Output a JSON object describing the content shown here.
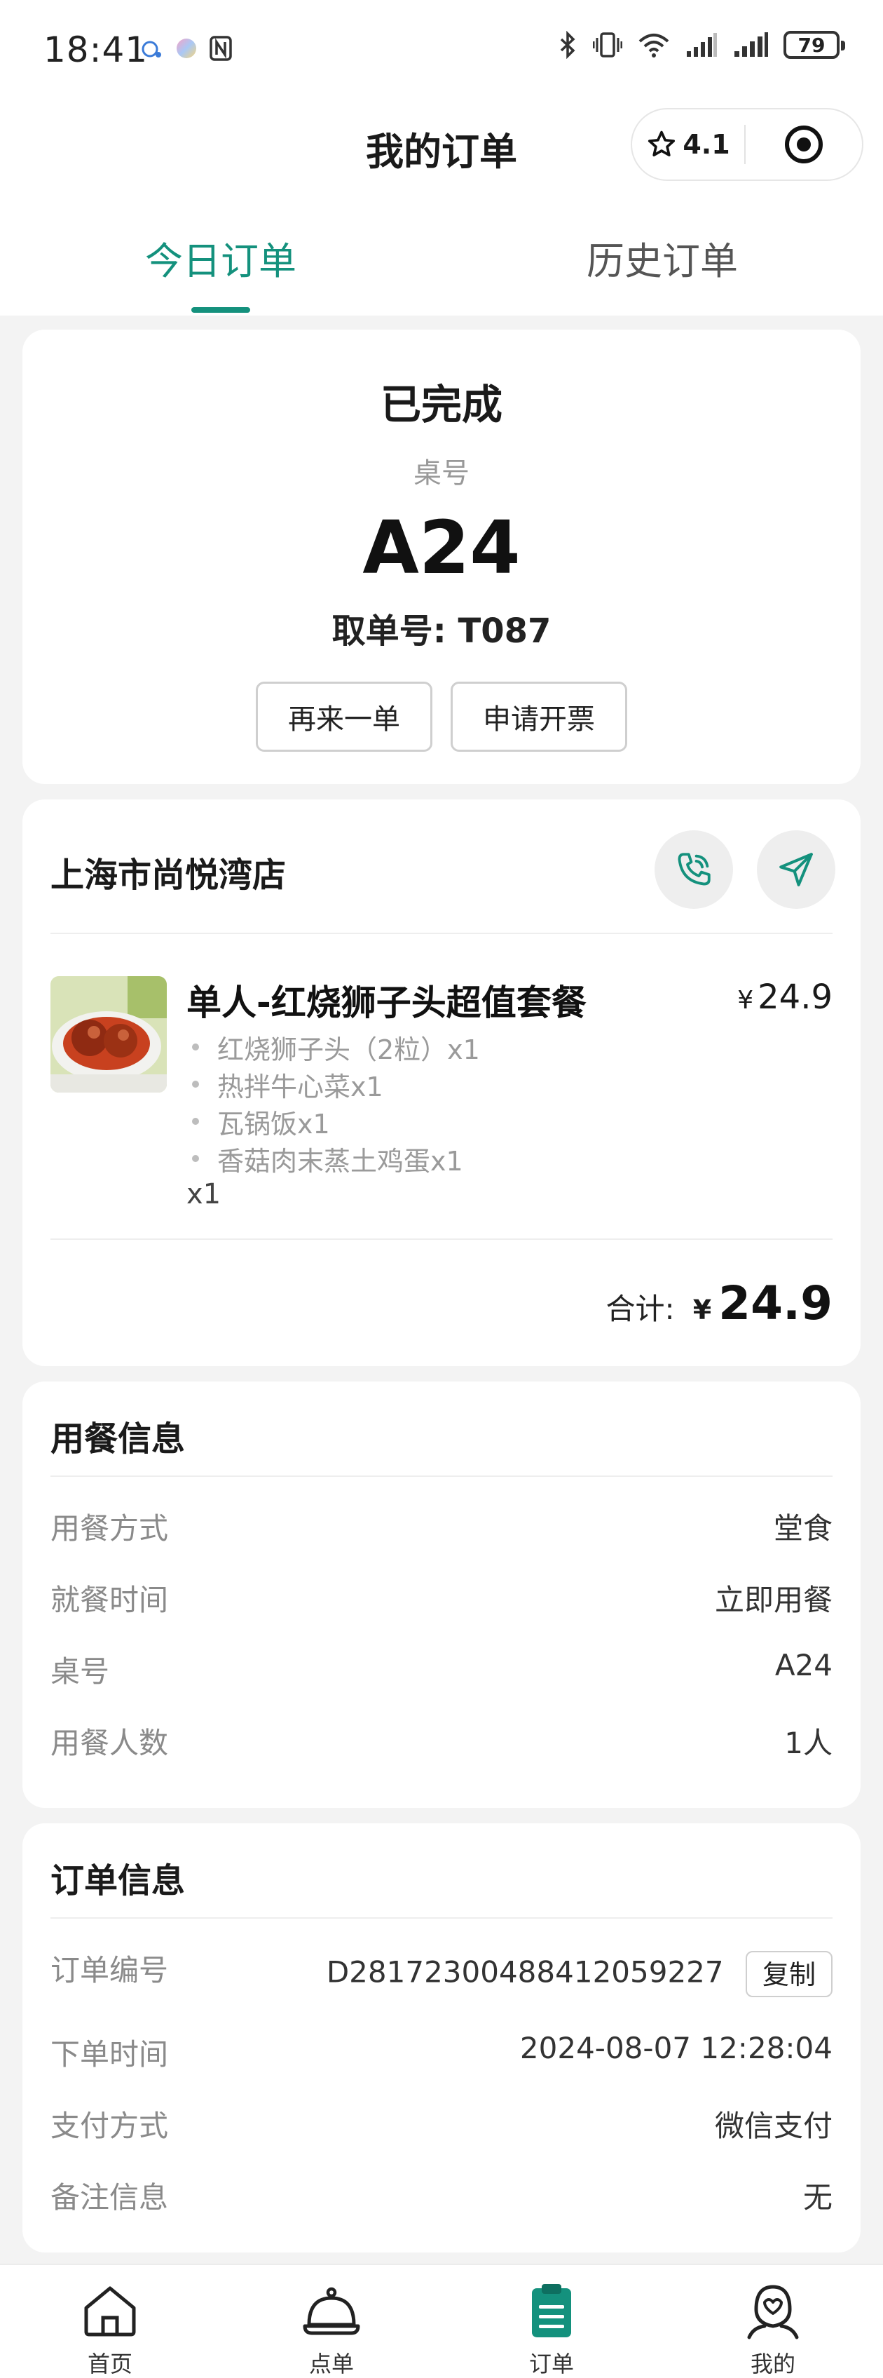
{
  "status_bar": {
    "time": "18:41",
    "battery": "79"
  },
  "header": {
    "title": "我的订单",
    "rating": "4.1"
  },
  "tabs": {
    "today": "今日订单",
    "history": "历史订单"
  },
  "order_status": {
    "status": "已完成",
    "table_label": "桌号",
    "table_number": "A24",
    "pickup": "取单号: T087",
    "reorder_button": "再来一单",
    "invoice_button": "申请开票"
  },
  "store": {
    "name": "上海市尚悦湾店",
    "item": {
      "name": "单人-红烧狮子头超值套餐",
      "currency": "¥",
      "price": "24.9",
      "sub_items": [
        "红烧狮子头（2粒）x1",
        "热拌牛心菜x1",
        "瓦锅饭x1",
        "香菇肉末蒸土鸡蛋x1"
      ],
      "quantity": "x1"
    },
    "total_label": "合计:",
    "total_currency": "¥",
    "total_amount": "24.9"
  },
  "dining_info": {
    "title": "用餐信息",
    "rows": [
      {
        "label": "用餐方式",
        "value": "堂食"
      },
      {
        "label": "就餐时间",
        "value": "立即用餐"
      },
      {
        "label": "桌号",
        "value": "A24"
      },
      {
        "label": "用餐人数",
        "value": "1人"
      }
    ]
  },
  "order_info": {
    "title": "订单信息",
    "rows": [
      {
        "label": "订单编号",
        "value": "D28172300488412059227"
      },
      {
        "label": "下单时间",
        "value": "2024-08-07 12:28:04"
      },
      {
        "label": "支付方式",
        "value": "微信支付"
      },
      {
        "label": "备注信息",
        "value": "无"
      }
    ],
    "copy_button": "复制"
  },
  "bottom_nav": {
    "items": [
      {
        "label": "首页",
        "icon": "home-icon"
      },
      {
        "label": "点单",
        "icon": "cloche-icon"
      },
      {
        "label": "订单",
        "icon": "clipboard-icon"
      },
      {
        "label": "我的",
        "icon": "profile-icon"
      }
    ],
    "active_color": "#14917d"
  },
  "colors": {
    "accent": "#14917d",
    "background": "#f3f3f3"
  }
}
